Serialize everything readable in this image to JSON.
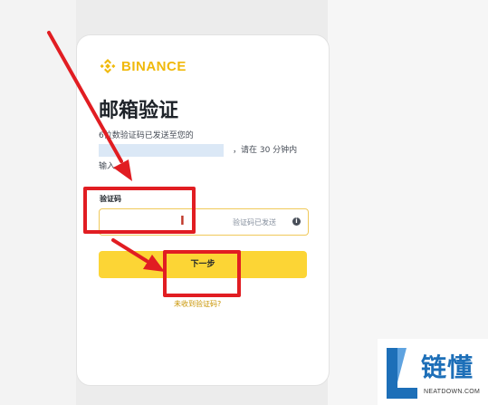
{
  "brand": {
    "name": "BINANCE",
    "color": "#F0B90B"
  },
  "page": {
    "title": "邮箱验证",
    "desc_line1": "6位数验证码已发送至您的",
    "desc_line2_suffix": "，请在 30 分钟内",
    "desc_line3": "输入。"
  },
  "form": {
    "code_label": "验证码",
    "code_value": "",
    "code_status": "验证码已发送",
    "info_icon": "info-icon"
  },
  "buttons": {
    "next_label": "下一步",
    "resend_label": "未收到验证码?"
  },
  "annotations": {
    "highlight_color": "#e11d22"
  },
  "watermark": {
    "name": "链懂",
    "site": "NEATDOWN.COM"
  }
}
